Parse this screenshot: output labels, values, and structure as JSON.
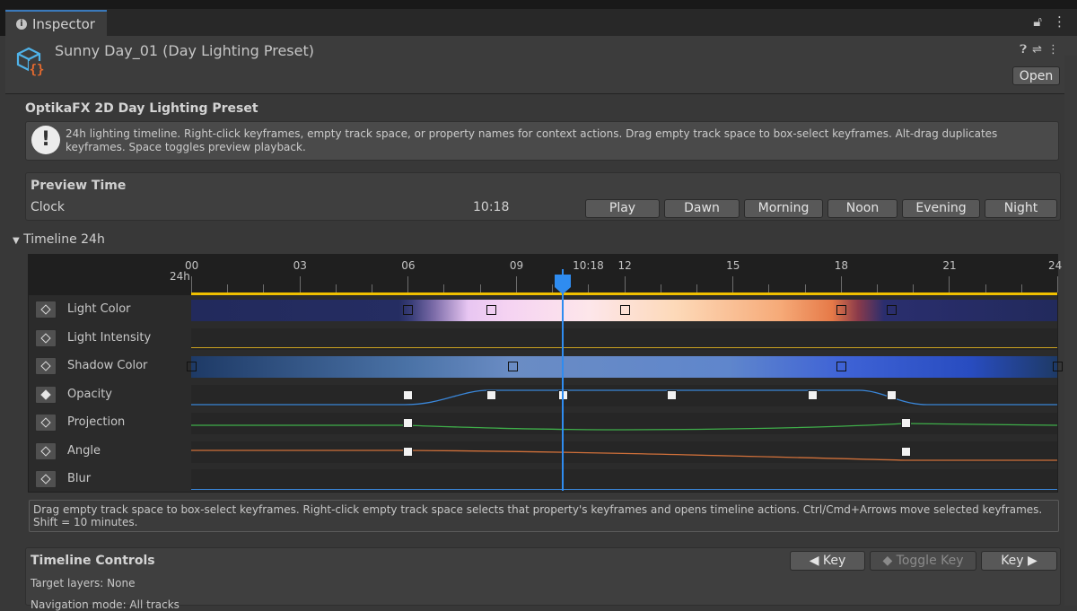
{
  "tab": {
    "label": "Inspector",
    "icon": "info-icon"
  },
  "window_icons": [
    "lock-icon",
    "menu-icon"
  ],
  "header": {
    "title": "Sunny Day_01 (Day Lighting Preset)",
    "icon": "cube-script-icon",
    "icons": [
      "help-icon",
      "settings-sliders-icon",
      "menu-icon"
    ],
    "open_label": "Open"
  },
  "preset_title": "OptikaFX 2D Day Lighting Preset",
  "help_text": "24h lighting timeline. Right-click keyframes, empty track space, or property names for context actions. Drag empty track space to box-select keyframes. Alt-drag duplicates keyframes. Space toggles preview playback.",
  "preview": {
    "title": "Preview Time",
    "clock_label": "Clock",
    "time": "10:18",
    "buttons": [
      "Play",
      "Dawn",
      "Morning",
      "Noon",
      "Evening",
      "Night"
    ]
  },
  "timeline": {
    "foldout_label": "Timeline 24h",
    "hour_labels": [
      "00",
      "03",
      "06",
      "09",
      "12",
      "15",
      "18",
      "21",
      "24"
    ],
    "start_sub_label": "24h",
    "playhead_label": "10:18",
    "playhead_hour": 10.3,
    "tracks": [
      {
        "name": "Light Color",
        "keyed": false,
        "keys": [
          6,
          8.3,
          12,
          18,
          19.4
        ]
      },
      {
        "name": "Light Intensity",
        "keyed": false,
        "keys": []
      },
      {
        "name": "Shadow Color",
        "keyed": false,
        "keys": [
          0,
          8.9,
          18,
          24
        ]
      },
      {
        "name": "Opacity",
        "keyed": true,
        "keys": [
          6,
          8.3,
          10.3,
          13.3,
          17.2,
          19.4
        ]
      },
      {
        "name": "Projection",
        "keyed": false,
        "keys": [
          6,
          19.8
        ]
      },
      {
        "name": "Angle",
        "keyed": false,
        "keys": [
          6,
          19.8
        ]
      },
      {
        "name": "Blur",
        "keyed": false,
        "keys": []
      }
    ],
    "help_text": "Drag empty track space to box-select keyframes. Right-click empty track space selects that property's keyframes and opens timeline actions. Ctrl/Cmd+Arrows move selected keyframes. Shift = 10 minutes."
  },
  "controls": {
    "title": "Timeline Controls",
    "prev_key": "◀ Key",
    "toggle_key": "Toggle Key",
    "next_key": "Key ▶",
    "target_layers": "Target layers: None",
    "navigation_mode": "Navigation mode: All tracks"
  },
  "colors": {
    "accent": "#2f8cf0",
    "ruler_line": "#f0c000",
    "projection_curve": "#3fae4a",
    "angle_curve": "#d0703a"
  }
}
